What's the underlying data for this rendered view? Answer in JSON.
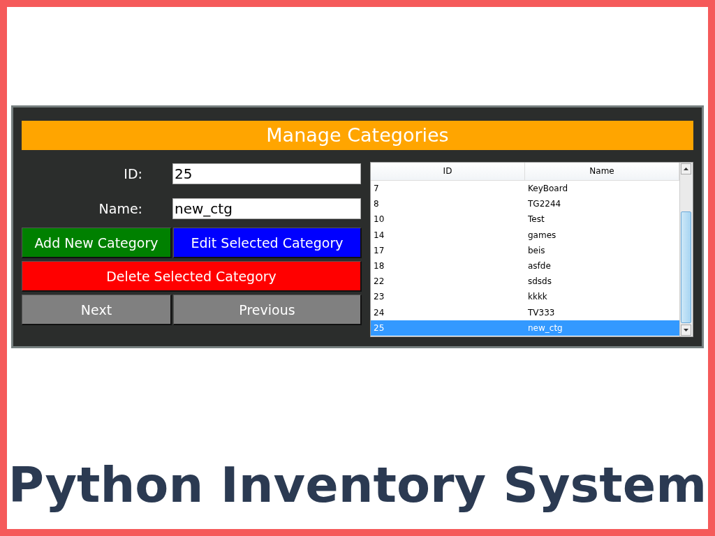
{
  "window": {
    "title": "Manage Categories"
  },
  "form": {
    "fields": [
      {
        "label": "ID:",
        "value": "25"
      },
      {
        "label": "Name:",
        "value": "new_ctg"
      }
    ]
  },
  "buttons": [
    {
      "label": "Add New Category",
      "kind": "add"
    },
    {
      "label": "Edit Selected Category",
      "kind": "edit"
    },
    {
      "label": "Delete Selected Category",
      "kind": "delete"
    },
    {
      "label": "Next",
      "kind": "nav"
    },
    {
      "label": "Previous",
      "kind": "nav"
    }
  ],
  "table": {
    "columns": [
      "ID",
      "Name"
    ],
    "rows": [
      {
        "id": "7",
        "name": "KeyBoard",
        "selected": false
      },
      {
        "id": "8",
        "name": "TG2244",
        "selected": false
      },
      {
        "id": "10",
        "name": "Test",
        "selected": false
      },
      {
        "id": "14",
        "name": "games",
        "selected": false
      },
      {
        "id": "17",
        "name": "beis",
        "selected": false
      },
      {
        "id": "18",
        "name": "asfde",
        "selected": false
      },
      {
        "id": "22",
        "name": "sdsds",
        "selected": false
      },
      {
        "id": "23",
        "name": "kkkk",
        "selected": false
      },
      {
        "id": "24",
        "name": "TV333",
        "selected": false
      },
      {
        "id": "25",
        "name": "new_ctg",
        "selected": true
      }
    ]
  },
  "caption": "Python Inventory System"
}
